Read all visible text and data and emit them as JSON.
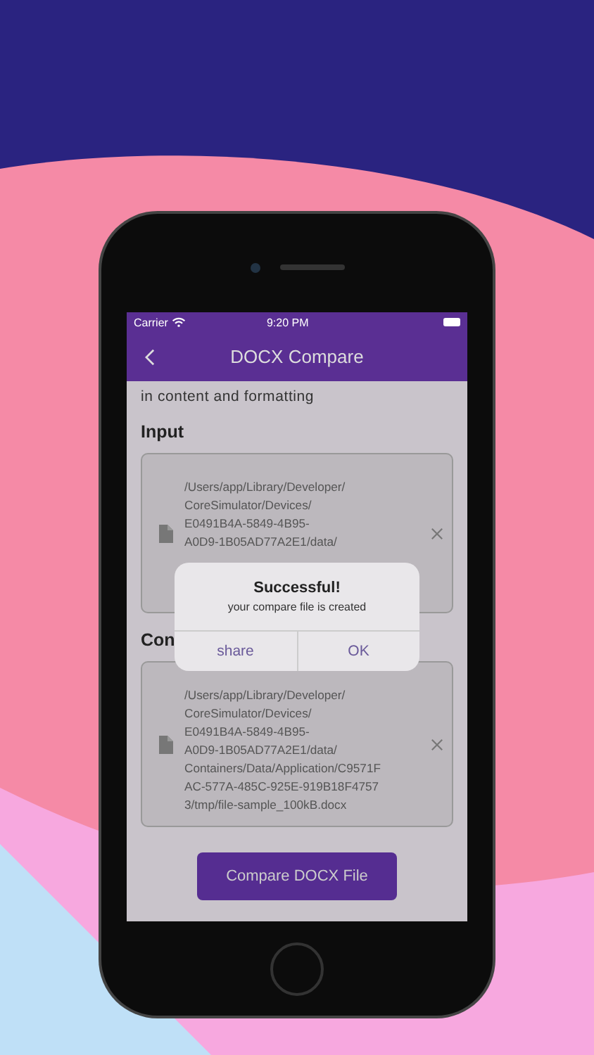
{
  "status_bar": {
    "carrier": "Carrier",
    "time": "9:20 PM"
  },
  "nav": {
    "title": "DOCX Compare"
  },
  "intro": "in content and formatting",
  "sections": [
    {
      "heading": "Input",
      "path_lines": [
        "/Users/app/Library/Developer/",
        "CoreSimulator/Devices/",
        "E0491B4A-5849-4B95-",
        "A0D9-1B05AD77A2E1/data/"
      ]
    },
    {
      "heading": "Con",
      "path_lines": [
        "/Users/app/Library/Developer/",
        "CoreSimulator/Devices/",
        "E0491B4A-5849-4B95-",
        "A0D9-1B05AD77A2E1/data/",
        "Containers/Data/Application/C9571F",
        "AC-577A-485C-925E-919B18F4757",
        "3/tmp/file-sample_100kB.docx"
      ]
    }
  ],
  "compare_button": "Compare DOCX File",
  "alert": {
    "title": "Successful!",
    "message": "your compare file is created",
    "buttons": [
      "share",
      "OK"
    ]
  }
}
